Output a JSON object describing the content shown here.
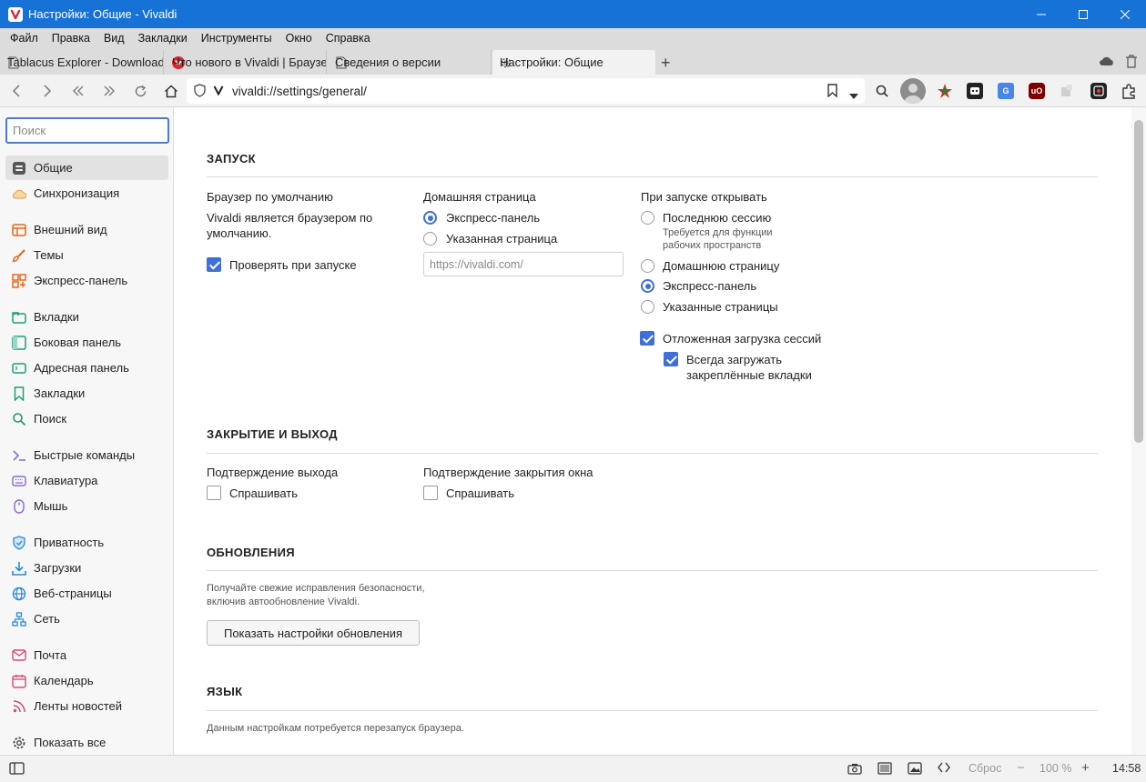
{
  "window": {
    "title": "Настройки: Общие - Vivaldi"
  },
  "menu": [
    "Файл",
    "Правка",
    "Вид",
    "Закладки",
    "Инструменты",
    "Окно",
    "Справка"
  ],
  "tabs": [
    {
      "label": "Tablacus Explorer - Download"
    },
    {
      "label": "Что нового в Vivaldi | Браузер"
    },
    {
      "label": "Сведения о версии"
    },
    {
      "label": "Настройки: Общие"
    }
  ],
  "address": {
    "url": "vivaldi://settings/general/"
  },
  "sidebar": {
    "search_placeholder": "Поиск",
    "items": [
      {
        "label": "Общие"
      },
      {
        "label": "Синхронизация"
      },
      {
        "label": "Внешний вид"
      },
      {
        "label": "Темы"
      },
      {
        "label": "Экспресс-панель"
      },
      {
        "label": "Вкладки"
      },
      {
        "label": "Боковая панель"
      },
      {
        "label": "Адресная панель"
      },
      {
        "label": "Закладки"
      },
      {
        "label": "Поиск"
      },
      {
        "label": "Быстрые команды"
      },
      {
        "label": "Клавиатура"
      },
      {
        "label": "Мышь"
      },
      {
        "label": "Приватность"
      },
      {
        "label": "Загрузки"
      },
      {
        "label": "Веб-страницы"
      },
      {
        "label": "Сеть"
      },
      {
        "label": "Почта"
      },
      {
        "label": "Календарь"
      },
      {
        "label": "Ленты новостей"
      },
      {
        "label": "Показать все"
      }
    ]
  },
  "startup": {
    "title": "ЗАПУСК",
    "default_browser": {
      "heading": "Браузер по умолчанию",
      "line1": "Vivaldi является браузером по",
      "line2": "умолчанию.",
      "check_label": "Проверять при запуске",
      "check_on": true
    },
    "homepage": {
      "heading": "Домашняя страница",
      "opt1": "Экспресс-панель",
      "opt2": "Указанная страница",
      "selected": 0,
      "placeholder": "https://vivaldi.com/"
    },
    "on_start": {
      "heading": "При запуске открывать",
      "opt_last": "Последнюю сессию",
      "opt_last_note1": "Требуется для функции",
      "opt_last_note2": "рабочих пространств",
      "opt_home": "Домашнюю страницу",
      "opt_speeddial": "Экспресс-панель",
      "opt_pages": "Указанные страницы",
      "selected": 2,
      "lazy_label": "Отложенная загрузка сессий",
      "lazy_on": true,
      "pinned_label1": "Всегда загружать",
      "pinned_label2": "закреплённые вкладки",
      "pinned_on": true
    }
  },
  "closing": {
    "title": "ЗАКРЫТИЕ И ВЫХОД",
    "exit_heading": "Подтверждение выхода",
    "exit_check": "Спрашивать",
    "window_heading": "Подтверждение закрытия окна",
    "window_check": "Спрашивать"
  },
  "updates": {
    "title": "ОБНОВЛЕНИЯ",
    "desc1": "Получайте свежие исправления безопасности,",
    "desc2": "включив автообновление Vivaldi.",
    "button": "Показать настройки обновления"
  },
  "language": {
    "title": "ЯЗЫК",
    "desc": "Данным настройкам потребуется перезапуск браузера."
  },
  "status": {
    "reset": "Сброс",
    "zoom": "100 %",
    "time": "14:58"
  },
  "colors": {
    "titlebar": "#1672d6",
    "accent": "#3f6fd8"
  }
}
